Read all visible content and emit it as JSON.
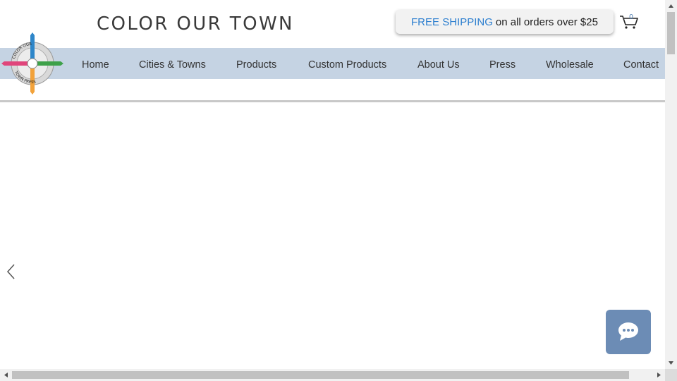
{
  "header": {
    "site_title": "COLOR  OUR  TOWN",
    "promo_highlight": "FREE SHIPPING",
    "promo_text": "on all orders over $25",
    "cart_count": "0"
  },
  "logo": {
    "ring_top": "COLOR OUR",
    "ring_bottom": "TOWN PRESS"
  },
  "nav": {
    "items": [
      {
        "label": "Home"
      },
      {
        "label": "Cities & Towns"
      },
      {
        "label": "Products"
      },
      {
        "label": "Custom Products"
      },
      {
        "label": "About Us"
      },
      {
        "label": "Press"
      },
      {
        "label": "Wholesale"
      },
      {
        "label": "Contact"
      }
    ]
  },
  "colors": {
    "nav_background": "#c5d3e3",
    "promo_highlight": "#2d7fcf",
    "chat_button": "#6c8cb5"
  },
  "icons": [
    "cart-icon",
    "chevron-left-icon",
    "chat-bubble-icon",
    "compass-logo"
  ]
}
